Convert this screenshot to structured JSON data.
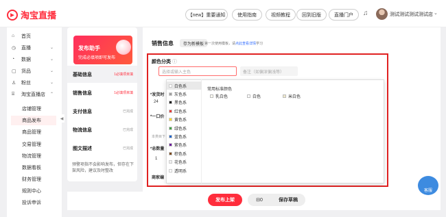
{
  "header": {
    "logo_text": "淘宝直播",
    "buttons": [
      "【new】重要通知",
      "使用指南",
      "视频教程",
      "回到旧版",
      "直播门户"
    ],
    "user_name": "测试测试测试测试店"
  },
  "sidebar": {
    "items": [
      {
        "label": "首页",
        "icon": "home-icon",
        "chev": ""
      },
      {
        "label": "直播",
        "icon": "live-icon",
        "chev": "⌄"
      },
      {
        "label": "数据",
        "icon": "data-icon",
        "chev": "⌄"
      },
      {
        "label": "货品",
        "icon": "goods-icon",
        "chev": "⌄"
      },
      {
        "label": "粉丝",
        "icon": "fans-icon",
        "chev": "⌄"
      },
      {
        "label": "淘宝直播店",
        "icon": "shop-icon",
        "chev": "⌃"
      }
    ],
    "sub_items": [
      "店铺管理",
      "商品发布",
      "商品管理",
      "交易管理",
      "物流管理",
      "数据看板",
      "财务管理",
      "规则中心",
      "投诉申诉"
    ]
  },
  "assistant": {
    "title": "发布助手",
    "subtitle": "完成必填项即可发布"
  },
  "steps": [
    {
      "name": "基础信息",
      "status": "1必填项未填",
      "warn": true
    },
    {
      "name": "销售信息",
      "status": "1必填项未填",
      "warn": true
    },
    {
      "name": "支付信息",
      "status": "已完成",
      "warn": false
    },
    {
      "name": "物流信息",
      "status": "已完成",
      "warn": false
    },
    {
      "name": "图文描述",
      "status": "已完成",
      "warn": false
    }
  ],
  "tip": "预警项指不会影响发布，但存在下架风险，建议及时整改",
  "sales": {
    "title": "销售信息",
    "template_button": "存为新模板",
    "hint_prefix": "第一次使用模板，请",
    "hint_link": "点此查看详情",
    "hint_suffix": "学习",
    "color_label": "颜色分类",
    "color_placeholder": "选择或输入主色",
    "note_placeholder": "备注（如偏深偏浅等）",
    "behind_labels": [
      "*发货时",
      "24",
      "*一口价",
      "本类目下",
      "*总数量",
      "1",
      "商家编"
    ]
  },
  "color_dropdown": {
    "categories": [
      {
        "label": "白色系",
        "color": "#ffffff"
      },
      {
        "label": "灰色系",
        "color": "#9e9e9e"
      },
      {
        "label": "黑色系",
        "color": "#111111"
      },
      {
        "label": "红色系",
        "color": "#e53935"
      },
      {
        "label": "黄色系",
        "color": "#fdd835"
      },
      {
        "label": "绿色系",
        "color": "#43a047"
      },
      {
        "label": "蓝色系",
        "color": "#1e63c8"
      },
      {
        "label": "紫色系",
        "color": "#6a1b9a"
      },
      {
        "label": "棕色系",
        "color": "#7b4a1e"
      },
      {
        "label": "花色系",
        "color": "#f0f0f0"
      },
      {
        "label": "透明系",
        "color": "#ffffff"
      }
    ],
    "common_label": "常用标准颜色",
    "options": [
      {
        "label": "乳白色",
        "color": "#fffdf2"
      },
      {
        "label": "白色",
        "color": "#ffffff"
      },
      {
        "label": "米白色",
        "color": "#efe9cc"
      }
    ]
  },
  "footer": {
    "publish": "发布上架",
    "draft_count": "0",
    "save_draft": "保存草稿"
  },
  "kefu": "客服"
}
